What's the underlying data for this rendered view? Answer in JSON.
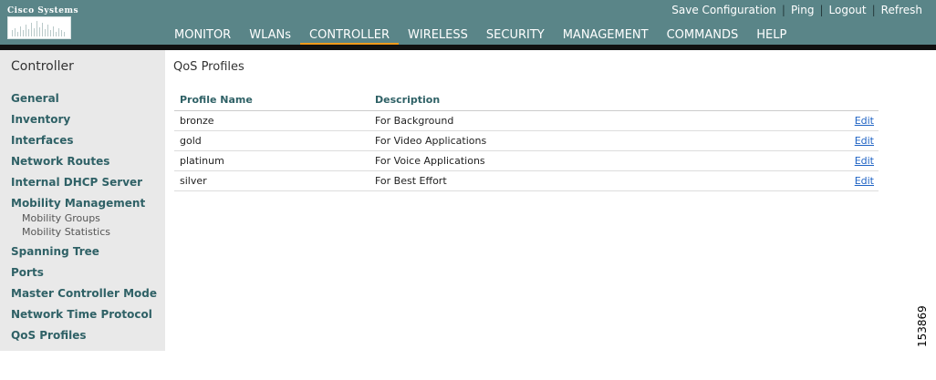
{
  "brand": {
    "name": "Cisco Systems"
  },
  "utility": {
    "save": "Save Configuration",
    "ping": "Ping",
    "logout": "Logout",
    "refresh": "Refresh"
  },
  "tabs": [
    {
      "label": "MONITOR"
    },
    {
      "label": "WLANs"
    },
    {
      "label": "CONTROLLER",
      "active": true
    },
    {
      "label": "WIRELESS"
    },
    {
      "label": "SECURITY"
    },
    {
      "label": "MANAGEMENT"
    },
    {
      "label": "COMMANDS"
    },
    {
      "label": "HELP"
    }
  ],
  "sidebar": {
    "title": "Controller",
    "items": [
      {
        "label": "General"
      },
      {
        "label": "Inventory"
      },
      {
        "label": "Interfaces"
      },
      {
        "label": "Network Routes"
      },
      {
        "label": "Internal DHCP Server"
      },
      {
        "label": "Mobility Management",
        "children": [
          {
            "label": "Mobility Groups"
          },
          {
            "label": "Mobility Statistics"
          }
        ]
      },
      {
        "label": "Spanning Tree"
      },
      {
        "label": "Ports"
      },
      {
        "label": "Master Controller Mode"
      },
      {
        "label": "Network Time Protocol"
      },
      {
        "label": "QoS Profiles"
      }
    ]
  },
  "main": {
    "title": "QoS Profiles",
    "table": {
      "headers": {
        "profile": "Profile Name",
        "description": "Description"
      },
      "rows": [
        {
          "profile": "bronze",
          "description": "For Background",
          "action": "Edit"
        },
        {
          "profile": "gold",
          "description": "For Video Applications",
          "action": "Edit"
        },
        {
          "profile": "platinum",
          "description": "For Voice Applications",
          "action": "Edit"
        },
        {
          "profile": "silver",
          "description": "For Best Effort",
          "action": "Edit"
        }
      ]
    }
  },
  "figure_number": "153869",
  "colors": {
    "header": "#5a8588",
    "active_tab_underline": "#f29b1d",
    "nav_text": "#2f6166",
    "link": "#1f63c4"
  }
}
